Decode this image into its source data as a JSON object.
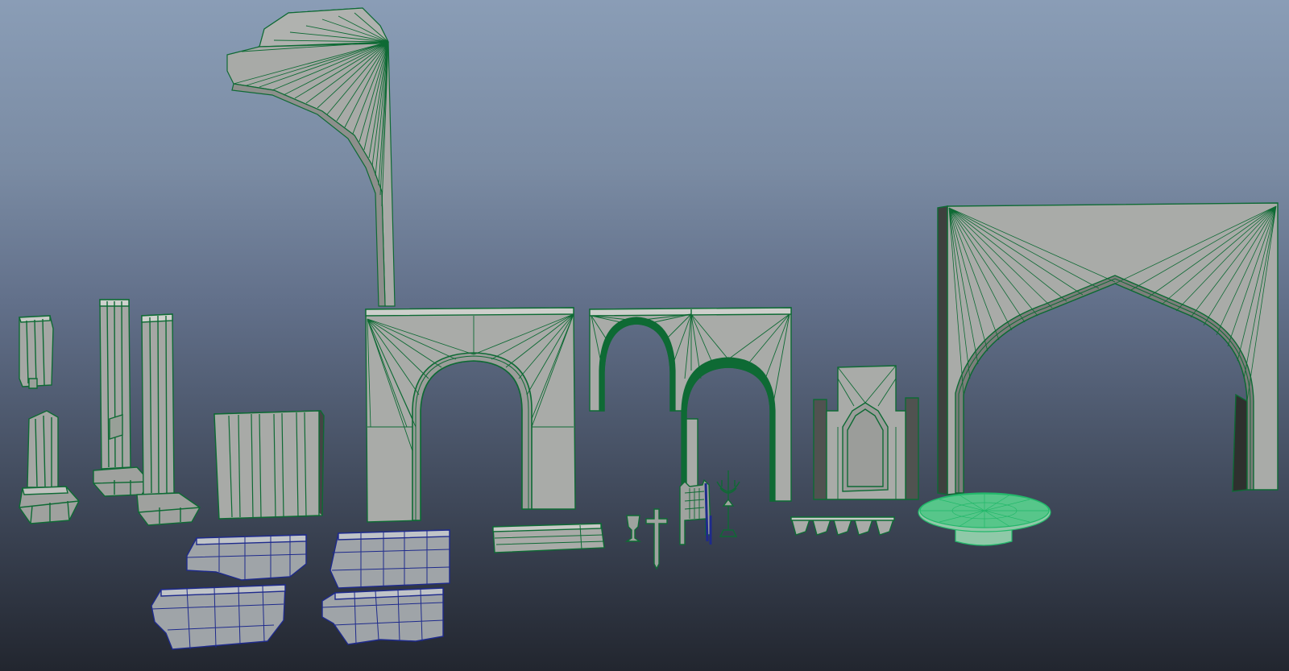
{
  "viewport": {
    "label": "",
    "wire_color": "#0e6a34",
    "wire_color_selected": "#22b86a",
    "wire_color_blue": "#1e2a8c",
    "mesh_fill": "#a8a8a6",
    "mesh_fill_dark": "#555555"
  },
  "scene": {
    "objects": [
      "broken-column-small",
      "broken-column-base",
      "column-tall-left",
      "column-tall-right",
      "wall-block",
      "curved-ceiling-piece",
      "arch-wall-large",
      "double-arch-wall",
      "stair-slab",
      "goblet",
      "sword",
      "throne-chair",
      "candelabra",
      "niche-window",
      "pointed-arch-wall",
      "bowl-row",
      "round-table",
      "floor-tiles"
    ]
  }
}
